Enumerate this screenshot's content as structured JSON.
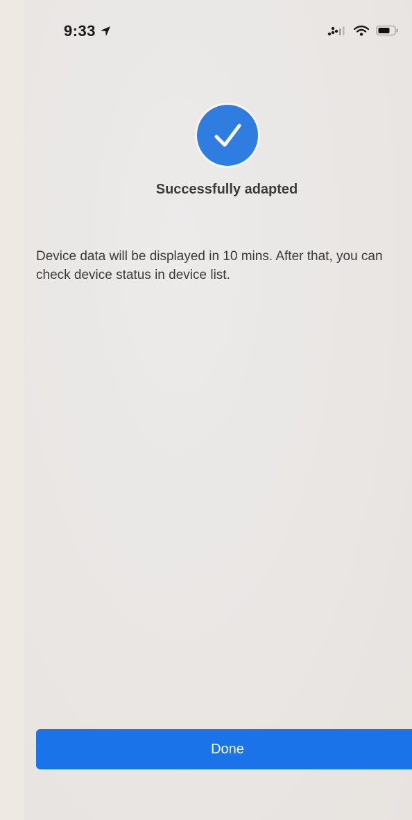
{
  "status_bar": {
    "time": "9:33",
    "location_icon": "location-arrow-icon",
    "signal_icon": "cellular-signal-icon",
    "wifi_icon": "wifi-icon",
    "battery_icon": "battery-icon"
  },
  "success": {
    "icon": "checkmark-circle-icon",
    "title": "Successfully adapted",
    "message": "Device data will be displayed in 10 mins. After that, you can check device status in device list."
  },
  "actions": {
    "done_label": "Done"
  },
  "colors": {
    "accent": "#1a73e8",
    "check_circle": "#2f7de1",
    "background": "#ebe8e5",
    "text": "#3a3a3a"
  }
}
